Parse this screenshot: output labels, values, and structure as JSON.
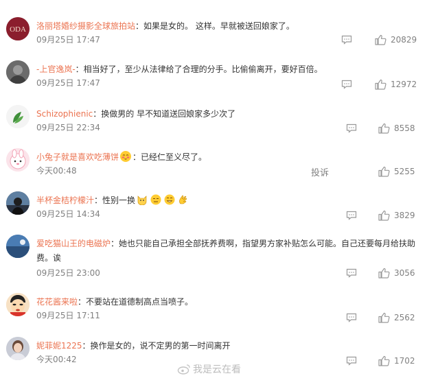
{
  "comments": [
    {
      "username": "洛丽塔婚纱摄影全球旅拍站",
      "text": "：如果是女的。 这样。早就被送回娘家了。",
      "time": "09月25日 17:47",
      "likes": "20829"
    },
    {
      "username": "-上官逸岚-",
      "text": "：相当好了，至少从法律给了合理的分手。比偷偷离开，要好百倍。",
      "time": "09月25日 17:47",
      "likes": "12972"
    },
    {
      "username": "Schizophienic",
      "text": "：换做男的 早不知道送回娘家多少次了",
      "time": "09月25日 22:34",
      "likes": "8558"
    },
    {
      "username": "小兔子就是喜欢吃薄饼",
      "text": "：已经仁至义尽了。",
      "time": "今天00:48",
      "likes": "5255",
      "report": "投诉"
    },
    {
      "username": "半杯金桔柠檬汁",
      "text": "：性别一换",
      "time": "09月25日 14:34",
      "likes": "3829"
    },
    {
      "username": "爱吃猫山王的电磁炉",
      "text": "：她也只能自己承担全部抚养费啊，指望男方家补贴怎么可能。自己还要每月给扶助费。诶",
      "time": "09月25日 23:00",
      "likes": "3056"
    },
    {
      "username": "花花酱来啦",
      "text": "：不要站在道德制高点当喷子。",
      "time": "09月25日 17:11",
      "likes": "2562"
    },
    {
      "username": "妮菲妮1225",
      "text": "：换作是女的，说不定男的第一时间离开",
      "time": "今天00:42",
      "likes": "1702"
    }
  ],
  "watermark": "我是云在看",
  "colors": {
    "username": "#eb7350",
    "meta": "#808080",
    "text": "#333333"
  }
}
